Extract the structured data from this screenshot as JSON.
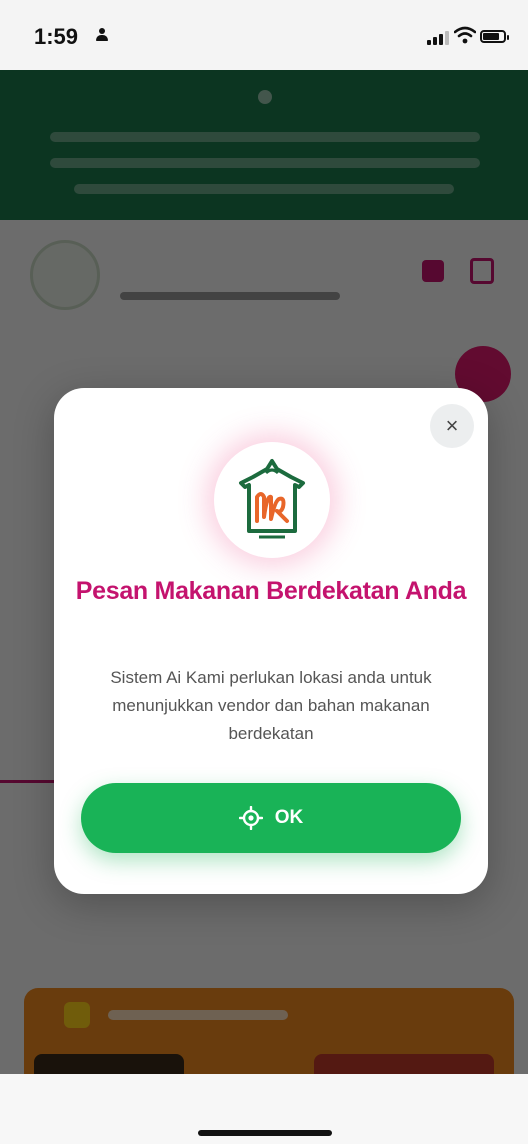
{
  "status_bar": {
    "time": "1:59"
  },
  "modal": {
    "title": "Pesan Makanan Berdekatan Anda",
    "description": "Sistem Ai Kami perlukan lokasi anda untuk menunjukkan vendor dan bahan makanan berdekatan",
    "ok_label": "OK",
    "close_icon": "×"
  },
  "colors": {
    "title": "#c4136e",
    "ok_button": "#19b357",
    "banner": "#1c7a4c"
  }
}
